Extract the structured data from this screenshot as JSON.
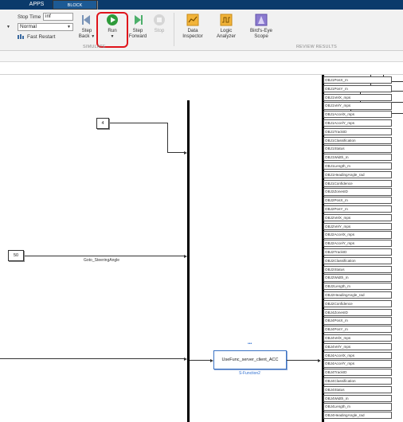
{
  "tabs": {
    "apps": "APPS",
    "block": "BLOCK"
  },
  "simulate": {
    "stop_time_label": "Stop Time",
    "stop_time_value": "inf",
    "mode_value": "Normal",
    "fast_restart_label": "Fast Restart",
    "step_back_label_1": "Step",
    "step_back_label_2": "Back",
    "run_label": "Run",
    "step_forward_label_1": "Step",
    "step_forward_label_2": "Forward",
    "stop_label": "Stop",
    "section_caption": "SIMULATE"
  },
  "review": {
    "data_inspector_1": "Data",
    "data_inspector_2": "Inspector",
    "logic_analyzer_1": "Logic",
    "logic_analyzer_2": "Analyzer",
    "birds_eye_1": "Bird's-Eye",
    "birds_eye_2": "Scope",
    "section_caption": "REVIEW RESULTS"
  },
  "canvas": {
    "const_block_value": "4",
    "const_block2_value": "50",
    "goto_label": "Goto_SteeringAngle",
    "sfunction_label": "UseFunc_server_client_ACC",
    "sfunction_caption": "S-Function2",
    "sfunction_dots": "•••"
  },
  "signals": [
    "OBJ1PosX_m",
    "OBJ1PosY_m",
    "OBJ1VelX_mps",
    "OBJ1VelY_mps",
    "OBJ1AccelX_mps",
    "OBJ1AccelY_mps",
    "OBJ1TrackID",
    "OBJ1Classification",
    "OBJ1Status",
    "OBJ1Width_m",
    "OBJ1Length_m",
    "OBJ1HeadingAngle_rad",
    "OBJ1Confidence",
    "OBJ2ZonesID",
    "OBJ2PosX_m",
    "OBJ2PosY_m",
    "OBJ2VelX_mps",
    "OBJ2VelY_mps",
    "OBJ2AccelX_mps",
    "OBJ2AccelY_mps",
    "OBJ2TrackID",
    "OBJ2Classification",
    "OBJ2Status",
    "OBJ2Width_m",
    "OBJ2Length_m",
    "OBJ2HeadingAngle_rad",
    "OBJ2Confidence",
    "OBJ4ZonesID",
    "OBJ4PosX_m",
    "OBJ4PosY_m",
    "OBJ4VelX_mps",
    "OBJ4VelY_mps",
    "OBJ4AccelX_mps",
    "OBJ4AccelY_mps",
    "OBJ4TrackID",
    "OBJ4Classification",
    "OBJ4Status",
    "OBJ4Width_m",
    "OBJ4Length_m",
    "OBJ4HeadingAngle_rad"
  ],
  "colors": {
    "tab_bar": "#0b3a6b",
    "run_highlight": "#e0141b",
    "run_icon": "#2e9b3a",
    "sfunction_border": "#3a72c4"
  }
}
